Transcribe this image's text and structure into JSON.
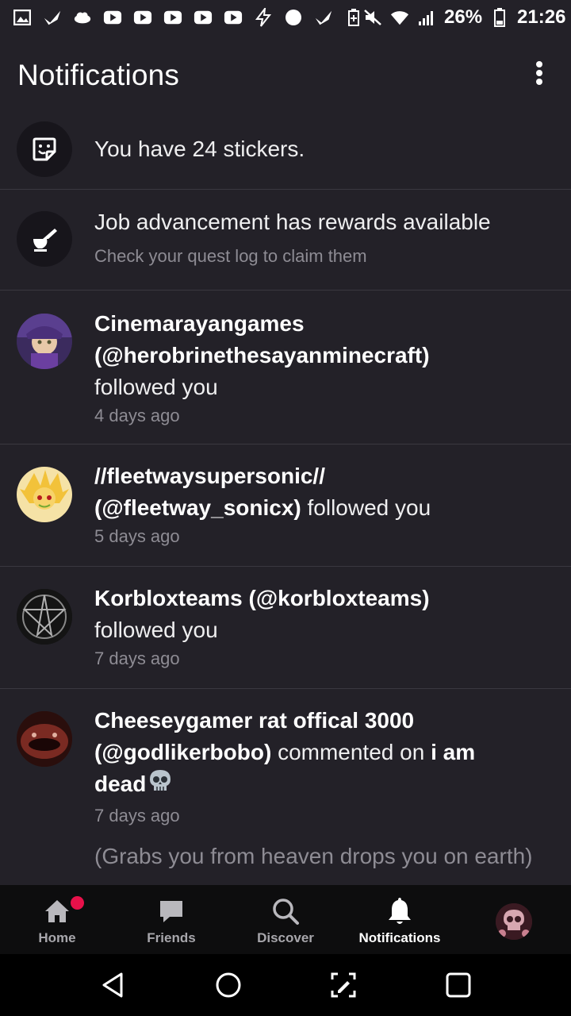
{
  "status_bar": {
    "battery": "26%",
    "time": "21:26"
  },
  "header": {
    "title": "Notifications"
  },
  "notifications": [
    {
      "type": "system",
      "icon": "sticker-icon",
      "text": "You have 24 stickers."
    },
    {
      "type": "system",
      "icon": "quest-icon",
      "title": "Job advancement has rewards available",
      "subtitle": "Check your quest log to claim them"
    },
    {
      "type": "follow",
      "name_line1": "Cinemarayangames",
      "name_line2": "(@herobrinethesayanminecraft)",
      "action": "followed you",
      "time": "4 days ago"
    },
    {
      "type": "follow",
      "name_line1": "//fleetwaysupersonic//",
      "name_line2": "(@fleetway_sonicx)",
      "action": "followed you",
      "time": "5 days ago"
    },
    {
      "type": "follow",
      "name_line1": "Korbloxteams (@korbloxteams)",
      "action": "followed you",
      "time": "7 days ago"
    },
    {
      "type": "comment",
      "name_line1": "Cheeseygamer rat offical 3000",
      "name_line2": "(@godlikerbobo)",
      "action": "commented on",
      "post": "i am",
      "post2": "dead",
      "time": "7 days ago",
      "quote": "(Grabs you from heaven  drops you on earth)"
    }
  ],
  "bottom_nav": {
    "tabs": [
      {
        "label": "Home",
        "icon": "home-icon"
      },
      {
        "label": "Friends",
        "icon": "chat-bubble-icon"
      },
      {
        "label": "Discover",
        "icon": "search-icon"
      },
      {
        "label": "Notifications",
        "icon": "bell-icon",
        "active": true
      },
      {
        "label": "",
        "icon": "profile-avatar"
      }
    ]
  },
  "colors": {
    "background": "#232128",
    "badge": "#e8114a",
    "nav_bg": "#0d0d0e"
  }
}
